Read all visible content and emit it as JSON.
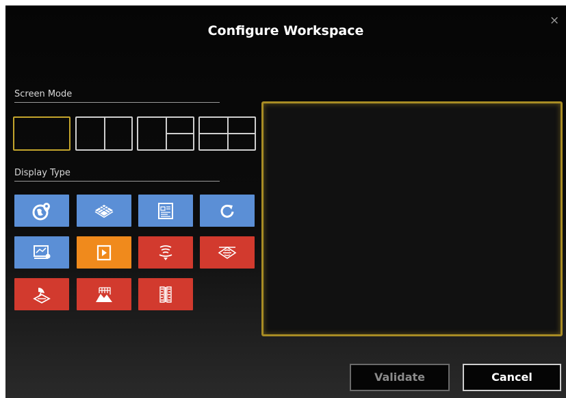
{
  "dialog": {
    "title": "Configure Workspace",
    "close_glyph": "×"
  },
  "screen_mode": {
    "label": "Screen Mode",
    "options": [
      {
        "name": "single-view",
        "selected": true
      },
      {
        "name": "two-vertical-split",
        "selected": false
      },
      {
        "name": "one-plus-two-split",
        "selected": false
      },
      {
        "name": "quad-split",
        "selected": false
      }
    ],
    "selected_color": "#c4a52c"
  },
  "display_type": {
    "label": "Display Type",
    "tiles": [
      {
        "icon": "globe-pin-icon",
        "color": "#5b8fd6"
      },
      {
        "icon": "grid-plane-icon",
        "color": "#5b8fd6"
      },
      {
        "icon": "map-sheet-icon",
        "color": "#5b8fd6"
      },
      {
        "icon": "refresh-icon",
        "color": "#5b8fd6"
      },
      {
        "icon": "video-screen-icon",
        "color": "#5b8fd6"
      },
      {
        "icon": "play-icon",
        "color": "#f08a1c"
      },
      {
        "icon": "sonar-waves-icon",
        "color": "#d23a2e"
      },
      {
        "icon": "radar-sweep-icon",
        "color": "#d23a2e"
      },
      {
        "icon": "satellite-dish-icon",
        "color": "#d23a2e"
      },
      {
        "icon": "terrain-grid-icon",
        "color": "#d23a2e"
      },
      {
        "icon": "side-scan-icon",
        "color": "#d23a2e"
      }
    ]
  },
  "buttons": {
    "validate": "Validate",
    "cancel": "Cancel"
  },
  "preview": {
    "border_color": "#a88c24"
  }
}
